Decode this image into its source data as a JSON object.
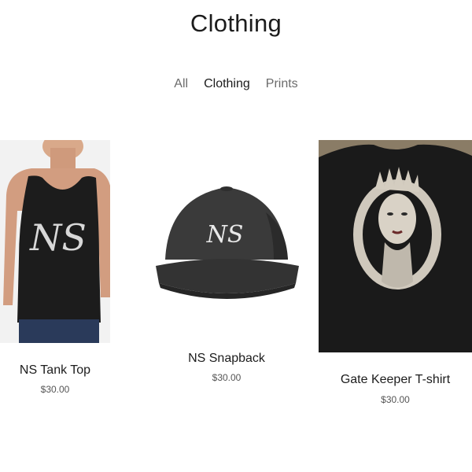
{
  "page": {
    "title": "Clothing"
  },
  "filters": [
    {
      "label": "All",
      "active": false
    },
    {
      "label": "Clothing",
      "active": true
    },
    {
      "label": "Prints",
      "active": false
    }
  ],
  "products": [
    {
      "name": "NS Tank Top",
      "price": "$30.00",
      "image": "tank-top-photo",
      "logo_text": "NS"
    },
    {
      "name": "NS Snapback",
      "price": "$30.00",
      "image": "snapback-cap-photo",
      "logo_text": "NS"
    },
    {
      "name": "Gate Keeper T-shirt",
      "price": "$30.00",
      "image": "t-shirt-photo"
    }
  ],
  "colors": {
    "text_primary": "#1c1c1c",
    "text_muted": "#6b6b6b",
    "garment_black": "#1a1a1a",
    "cap_gray": "#3a3a3a",
    "carpet_tan": "#8a7c66"
  }
}
